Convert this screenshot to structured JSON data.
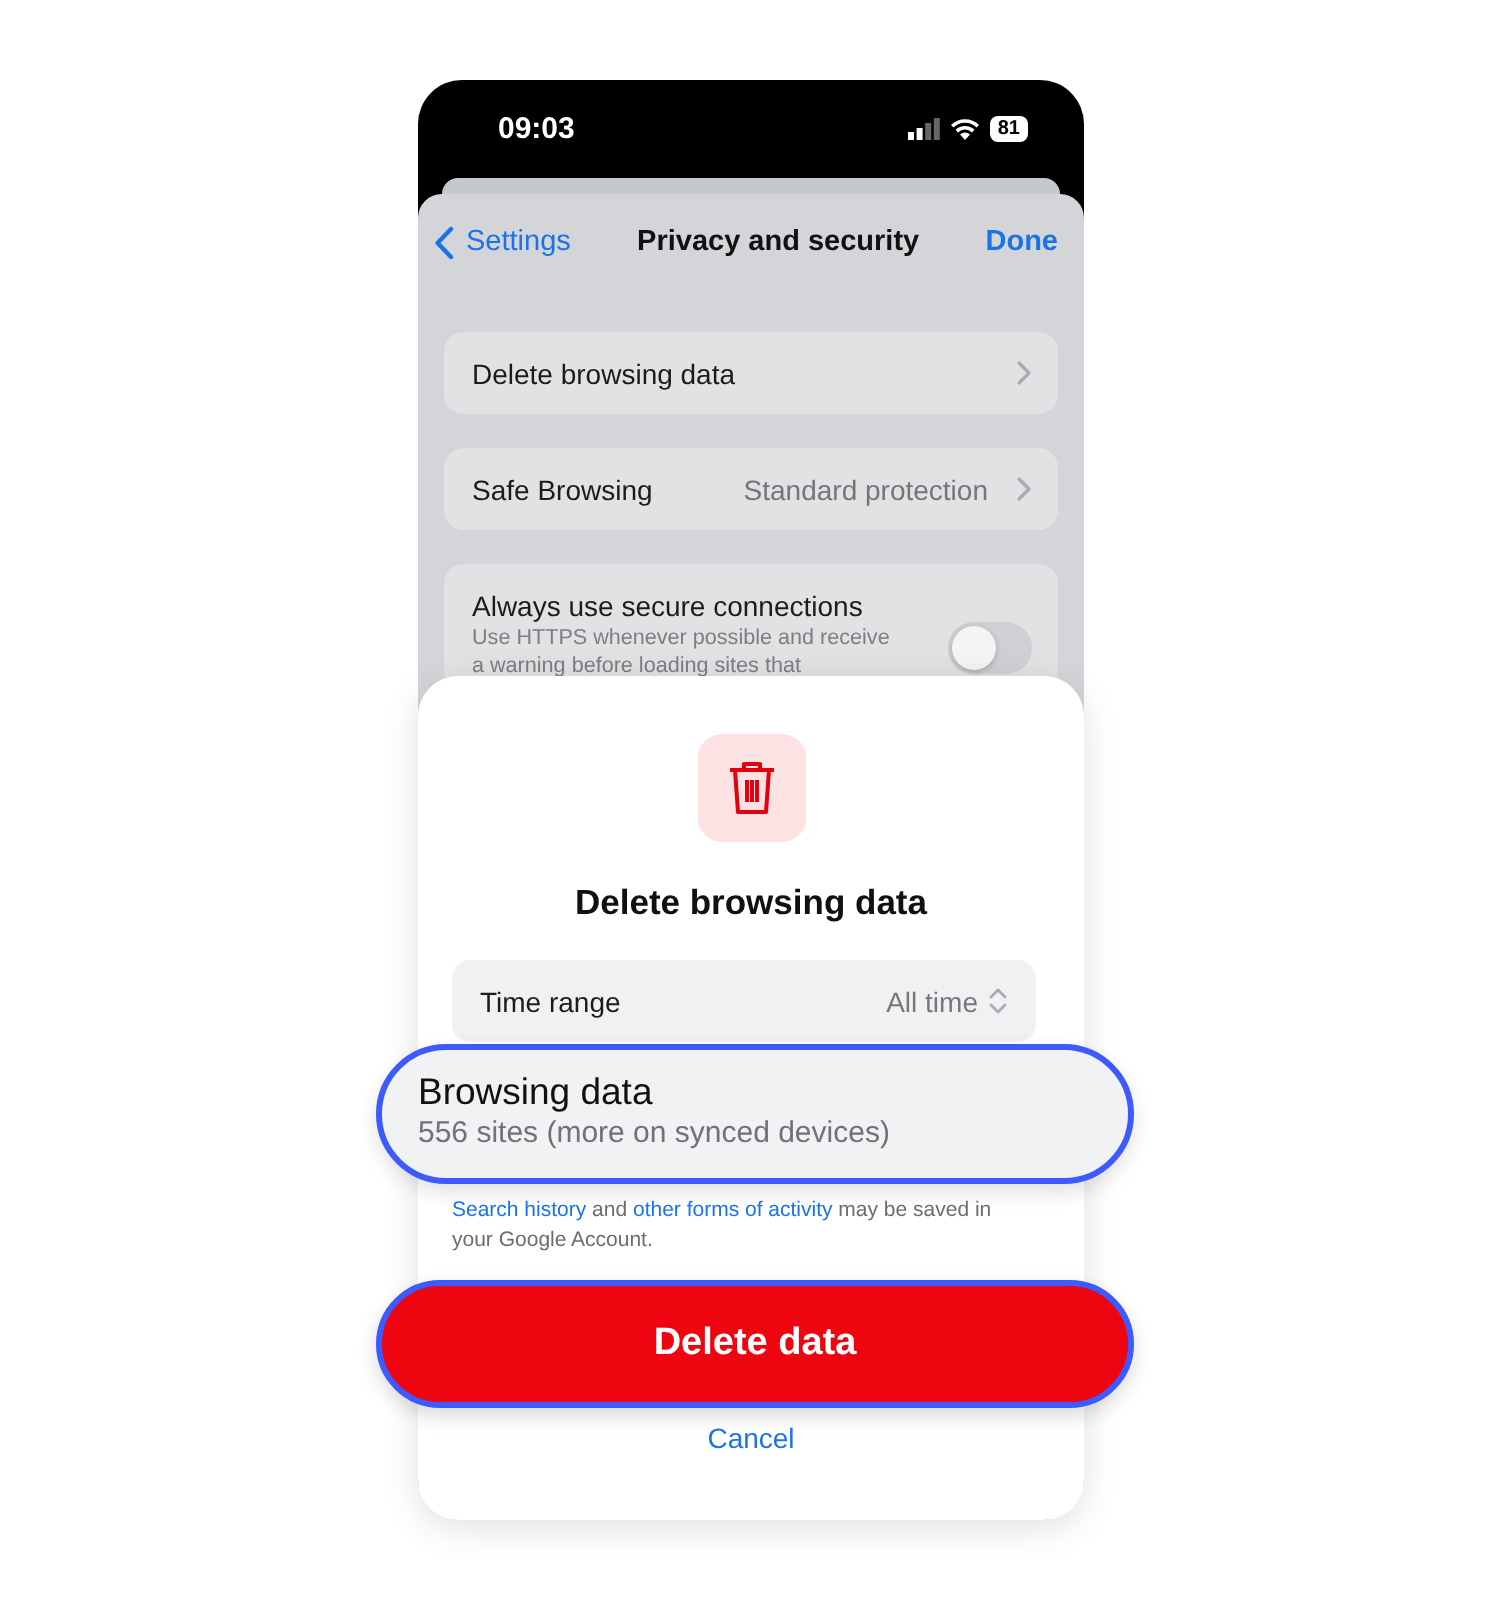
{
  "status_bar": {
    "time": "09:03",
    "battery": "81"
  },
  "nav": {
    "back": "Settings",
    "title": "Privacy and security",
    "done": "Done"
  },
  "settings_rows": [
    {
      "kind": "link",
      "label": "Delete browsing data"
    },
    {
      "kind": "link",
      "label": "Safe Browsing",
      "value": "Standard protection"
    },
    {
      "kind": "toggle",
      "label": "Always use secure connections",
      "description": "Use HTTPS whenever possible and receive a warning before loading sites that",
      "on": false
    }
  ],
  "sheet": {
    "title": "Delete browsing data",
    "time_range": {
      "label": "Time range",
      "value": "All time"
    },
    "browsing_data": {
      "title": "Browsing data",
      "subtitle": "556 sites (more on synced devices)"
    },
    "note": [
      {
        "kind": "link",
        "text": "Search history"
      },
      {
        "kind": "text",
        "text": " and "
      },
      {
        "kind": "link",
        "text": "other forms of activity"
      },
      {
        "kind": "text",
        "text": " may be saved in your Google Account."
      }
    ],
    "delete_button": "Delete data",
    "cancel": "Cancel"
  }
}
